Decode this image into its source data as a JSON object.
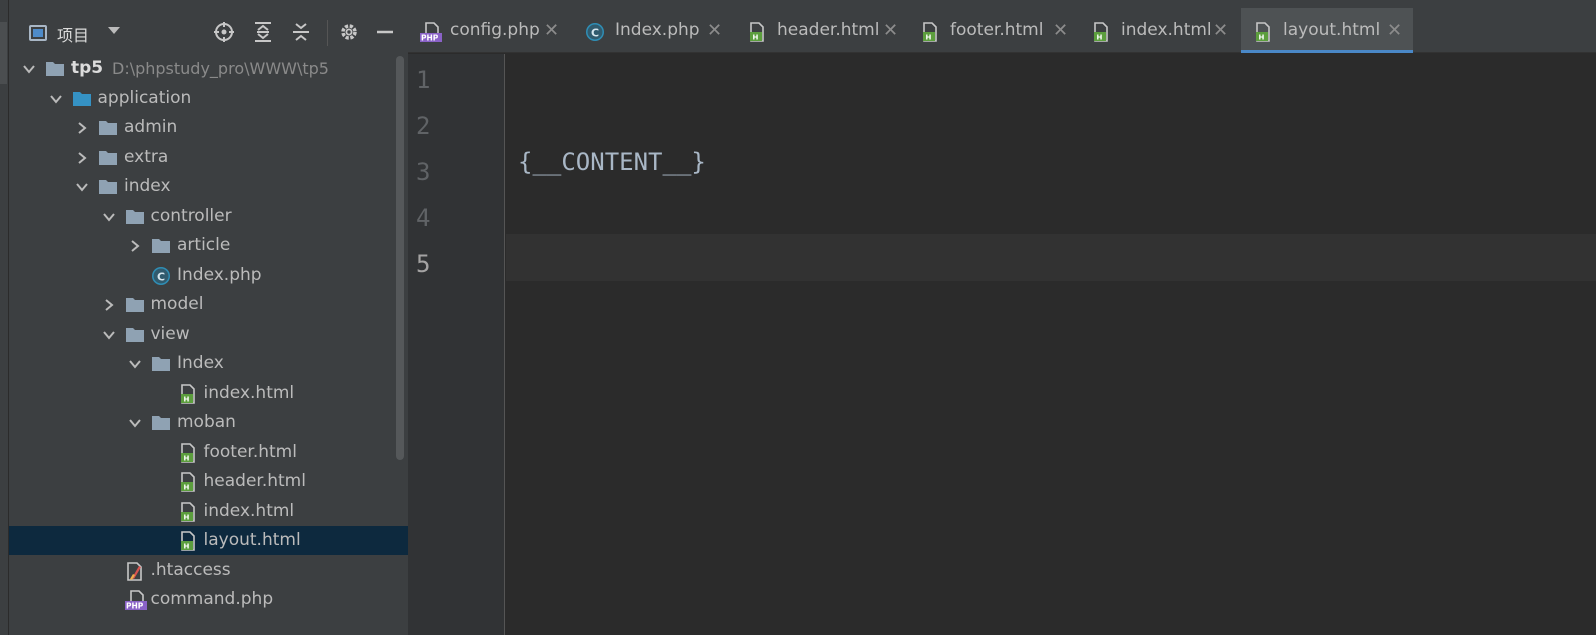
{
  "project_panel": {
    "title": "项目",
    "tree": [
      {
        "label": "tp5",
        "path": "D:\\phpstudy_pro\\WWW\\tp5",
        "icon": "folder-icon"
      },
      {
        "label": "application",
        "icon": "folder-icon"
      },
      {
        "label": "admin",
        "icon": "folder-icon"
      },
      {
        "label": "extra",
        "icon": "folder-icon"
      },
      {
        "label": "index",
        "icon": "folder-icon"
      },
      {
        "label": "controller",
        "icon": "folder-icon"
      },
      {
        "label": "article",
        "icon": "folder-icon"
      },
      {
        "label": "Index.php",
        "icon": "php-class-icon"
      },
      {
        "label": "model",
        "icon": "folder-icon"
      },
      {
        "label": "view",
        "icon": "folder-icon"
      },
      {
        "label": "Index",
        "icon": "folder-icon"
      },
      {
        "label": "index.html",
        "icon": "html-file-icon"
      },
      {
        "label": "moban",
        "icon": "folder-icon"
      },
      {
        "label": "footer.html",
        "icon": "html-file-icon"
      },
      {
        "label": "header.html",
        "icon": "html-file-icon"
      },
      {
        "label": "index.html",
        "icon": "html-file-icon"
      },
      {
        "label": "layout.html",
        "icon": "html-file-icon",
        "selected": true
      },
      {
        "label": ".htaccess",
        "icon": "htaccess-file-icon"
      },
      {
        "label": "command.php",
        "icon": "php-file-icon"
      }
    ]
  },
  "tabs": [
    {
      "label": "config.php",
      "icon": "php-file-icon"
    },
    {
      "label": "Index.php",
      "icon": "php-class-icon"
    },
    {
      "label": "header.html",
      "icon": "html-file-icon"
    },
    {
      "label": "footer.html",
      "icon": "html-file-icon"
    },
    {
      "label": "index.html",
      "icon": "html-file-icon"
    },
    {
      "label": "layout.html",
      "icon": "html-file-icon",
      "active": true
    }
  ],
  "editor": {
    "line_numbers": [
      "1",
      "2",
      "3",
      "4",
      "5"
    ],
    "current_line": "5",
    "code_line_3": "{__CONTENT__}"
  },
  "colors": {
    "folder": "#8fa2b3",
    "blue_folder": "#3592c4",
    "html_badge": "#5c9e3d",
    "php_badge": "#8a62c7",
    "accent": "#4a88c7",
    "selection": "#0d293e"
  },
  "icons": {
    "locate": "crosshair-icon",
    "expand": "expand-all-icon",
    "collapse": "collapse-all-icon",
    "settings": "gear-icon",
    "hide": "minus-icon",
    "close": "close-icon"
  }
}
